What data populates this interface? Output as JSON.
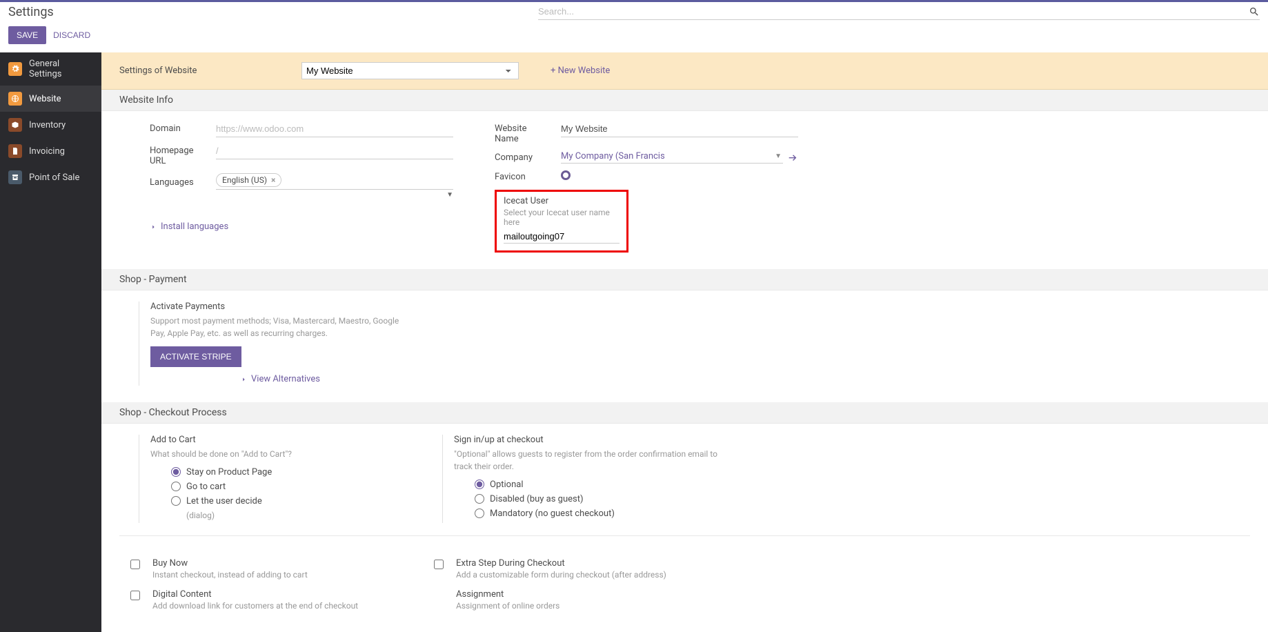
{
  "header": {
    "title": "Settings",
    "search_placeholder": "Search...",
    "save": "SAVE",
    "discard": "DISCARD"
  },
  "sidebar": {
    "items": [
      {
        "label": "General Settings"
      },
      {
        "label": "Website"
      },
      {
        "label": "Inventory"
      },
      {
        "label": "Invoicing"
      },
      {
        "label": "Point of Sale"
      }
    ]
  },
  "banner": {
    "label": "Settings of Website",
    "selected": "My Website",
    "new_website": "+ New Website"
  },
  "section_info": {
    "title": "Website Info",
    "domain_label": "Domain",
    "domain_placeholder": "https://www.odoo.com",
    "homepage_label": "Homepage URL",
    "homepage_placeholder": "/",
    "languages_label": "Languages",
    "language_tag": "English (US)",
    "install_link": "Install languages",
    "name_label": "Website Name",
    "name_value": "My Website",
    "company_label": "Company",
    "company_value": "My Company (San Francis",
    "favicon_label": "Favicon",
    "icecat": {
      "title": "Icecat User",
      "help": "Select your Icecat user name here",
      "value": "mailoutgoing07"
    }
  },
  "section_payment": {
    "title": "Shop - Payment",
    "activate_title": "Activate Payments",
    "activate_help": "Support most payment methods; Visa, Mastercard, Maestro, Google Pay, Apple Pay, etc. as well as recurring charges.",
    "stripe_btn": "ACTIVATE STRIPE",
    "alternatives": "View Alternatives"
  },
  "section_checkout": {
    "title": "Shop - Checkout Process",
    "add_to_cart": {
      "title": "Add to Cart",
      "help": "What should be done on \"Add to Cart\"?",
      "opt1": "Stay on Product Page",
      "opt2": "Go to cart",
      "opt3": "Let the user decide",
      "opt3_sub": "(dialog)"
    },
    "signin": {
      "title": "Sign in/up at checkout",
      "help": "\"Optional\" allows guests to register from the order confirmation email to track their order.",
      "opt1": "Optional",
      "opt2": "Disabled (buy as guest)",
      "opt3": "Mandatory (no guest checkout)"
    },
    "buy_now": {
      "title": "Buy Now",
      "help": "Instant checkout, instead of adding to cart"
    },
    "extra_step": {
      "title": "Extra Step During Checkout",
      "help": "Add a customizable form during checkout (after address)"
    },
    "digital": {
      "title": "Digital Content",
      "help": "Add download link for customers at the end of checkout"
    },
    "assignment": {
      "title": "Assignment",
      "help": "Assignment of online orders"
    }
  }
}
